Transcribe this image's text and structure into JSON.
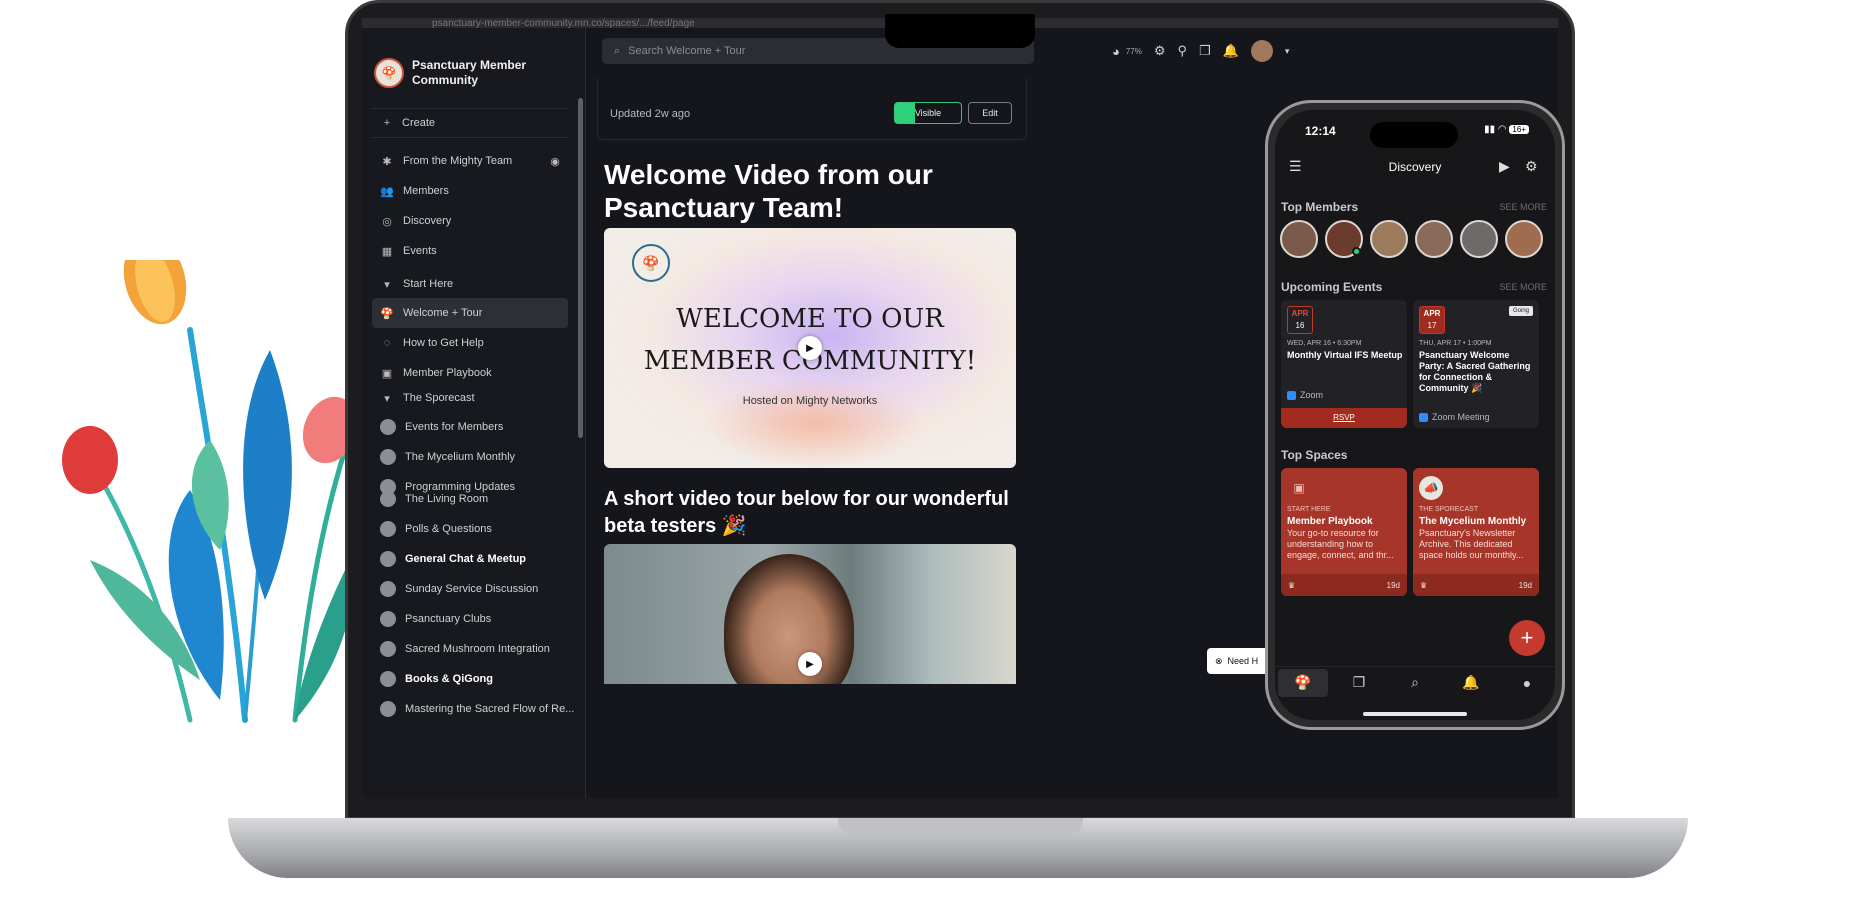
{
  "browser": {
    "url": "psanctuary-member-community.mn.co/spaces/.../feed/page"
  },
  "brand": {
    "name": "Psanctuary Member Community"
  },
  "sidebar": {
    "create": "Create",
    "top_items": [
      {
        "label": "From the Mighty Team",
        "icon": "mighty-icon"
      },
      {
        "label": "Members",
        "icon": "members-icon"
      },
      {
        "label": "Discovery",
        "icon": "compass-icon"
      },
      {
        "label": "Events",
        "icon": "calendar-icon"
      }
    ],
    "section1": "Start Here",
    "section1_items": [
      {
        "label": "Welcome + Tour"
      },
      {
        "label": "How to Get Help"
      },
      {
        "label": "Member Playbook"
      }
    ],
    "section2": "The Sporecast",
    "section2_items": [
      {
        "label": "Events for Members"
      },
      {
        "label": "The Mycelium Monthly"
      },
      {
        "label": "Programming Updates"
      }
    ],
    "more_items": [
      {
        "label": "The Living Room"
      },
      {
        "label": "Polls & Questions"
      },
      {
        "label": "General Chat & Meetup"
      },
      {
        "label": "Sunday Service Discussion"
      },
      {
        "label": "Psanctuary Clubs"
      },
      {
        "label": "Sacred Mushroom Integration"
      },
      {
        "label": "Books & QiGong"
      },
      {
        "label": "Mastering the Sacred Flow of Re..."
      }
    ]
  },
  "search": {
    "placeholder": "Search Welcome + Tour"
  },
  "topbar": {
    "progress": "77%"
  },
  "post": {
    "updated": "Updated 2w ago",
    "visible_label": "Visible",
    "edit_label": "Edit",
    "title": "Welcome Video from our Psanctuary Team!",
    "video_title_line1": "WELCOME TO OUR",
    "video_title_line2": "MEMBER COMMUNITY!",
    "video_subtitle": "Hosted on Mighty Networks",
    "subtitle": "A short video tour below for our wonderful beta testers 🎉",
    "need_help": "Need H"
  },
  "phone": {
    "time": "12:14",
    "battery": "16+",
    "title": "Discovery",
    "top_members": "Top Members",
    "see_more": "SEE MORE",
    "upcoming_events": "Upcoming Events",
    "events": [
      {
        "month": "APR",
        "day": "16",
        "when": "WED, APR 16 • 6:30PM",
        "title": "Monthly Virtual IFS Meetup",
        "location": "Zoom",
        "action": "RSVP"
      },
      {
        "month": "APR",
        "day": "17",
        "when": "THU, APR 17 • 1:00PM",
        "title": "Psanctuary Welcome Party: A Sacred Gathering for Connection & Community 🎉",
        "location": "Zoom Meeting",
        "badge": "Going"
      }
    ],
    "top_spaces": "Top Spaces",
    "spaces": [
      {
        "category": "START HERE",
        "title": "Member Playbook",
        "desc": "Your go-to resource for understanding how to engage, connect, and thr...",
        "age": "19d"
      },
      {
        "category": "THE SPORECAST",
        "title": "The Mycelium Monthly",
        "desc": "Psanctuary's Newsletter Archive. This dedicated space holds our monthly...",
        "age": "19d"
      }
    ]
  },
  "colors": {
    "accent_green": "#2fd07a",
    "brand_red": "#a8352a",
    "dark_bg": "#14161c"
  }
}
